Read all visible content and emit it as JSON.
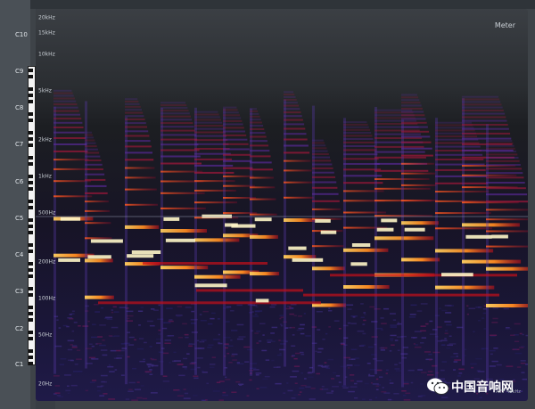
{
  "meter": {
    "label": "Meter"
  },
  "note_labels": [
    {
      "name": "C10",
      "freq": 16744
    },
    {
      "name": "C9",
      "freq": 8372
    },
    {
      "name": "C8",
      "freq": 4186
    },
    {
      "name": "C7",
      "freq": 2093
    },
    {
      "name": "C6",
      "freq": 1047
    },
    {
      "name": "C5",
      "freq": 523
    },
    {
      "name": "C4",
      "freq": 262
    },
    {
      "name": "C3",
      "freq": 131
    },
    {
      "name": "C2",
      "freq": 65
    },
    {
      "name": "C1",
      "freq": 33
    }
  ],
  "freq_labels": [
    {
      "text": "20kHz",
      "freq": 20000
    },
    {
      "text": "15kHz",
      "freq": 15000
    },
    {
      "text": "10kHz",
      "freq": 10000
    },
    {
      "text": "5kHz",
      "freq": 5000
    },
    {
      "text": "2kHz",
      "freq": 2000
    },
    {
      "text": "1kHz",
      "freq": 1000
    },
    {
      "text": "500Hz",
      "freq": 500
    },
    {
      "text": "200Hz",
      "freq": 200
    },
    {
      "text": "100Hz",
      "freq": 100
    },
    {
      "text": "50Hz",
      "freq": 50
    },
    {
      "text": "20Hz",
      "freq": 20
    }
  ],
  "watermark": {
    "text": "中国音响网"
  },
  "sample_info": {
    "text": "AIFF 48kHz"
  },
  "colors": {
    "background": "#3e4348",
    "spectrum_low": "#1a1638",
    "spectrum_mid": "#c4101a",
    "spectrum_high": "#ffd060",
    "peak": "#fff6c8"
  }
}
